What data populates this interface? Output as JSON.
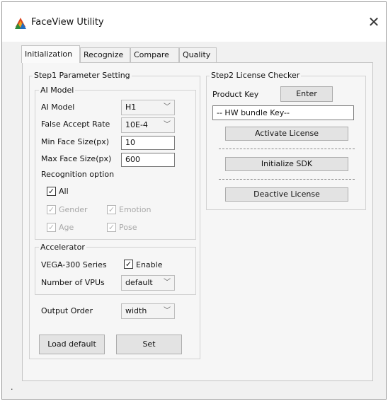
{
  "window": {
    "title": "FaceView Utility",
    "close_glyph": "✕"
  },
  "tabs": [
    {
      "label": "Initialization",
      "active": true
    },
    {
      "label": "Recognize",
      "active": false
    },
    {
      "label": "Compare",
      "active": false
    },
    {
      "label": "Quality",
      "active": false
    }
  ],
  "step1": {
    "title": "Step1 Parameter Setting",
    "ai_model_group": {
      "title": "AI Model",
      "ai_model_label": "AI Model",
      "ai_model_value": "H1",
      "far_label": "False Accept Rate",
      "far_value": "10E-4",
      "min_face_label": "Min Face Size(px)",
      "min_face_value": "10",
      "max_face_label": "Max Face Size(px)",
      "max_face_value": "600",
      "recognition_label": "Recognition option",
      "options": {
        "all": "All",
        "gender": "Gender",
        "emotion": "Emotion",
        "age": "Age",
        "pose": "Pose"
      }
    },
    "accelerator_group": {
      "title": "Accelerator",
      "series_label": "VEGA-300 Series",
      "enable_label": "Enable",
      "vpus_label": "Number of VPUs",
      "vpus_value": "default"
    },
    "output_order_label": "Output Order",
    "output_order_value": "width",
    "load_default_label": "Load default",
    "set_label": "Set"
  },
  "step2": {
    "title": "Step2 License Checker",
    "product_key_label": "Product Key",
    "enter_label": "Enter",
    "key_value": "-- HW bundle Key--",
    "activate_label": "Activate License",
    "initialize_label": "Initialize SDK",
    "deactive_label": "Deactive License"
  },
  "status": {
    "text": "."
  },
  "icons": {
    "app": "faceview-app-icon",
    "check": "✓",
    "arrow": "﹀"
  }
}
